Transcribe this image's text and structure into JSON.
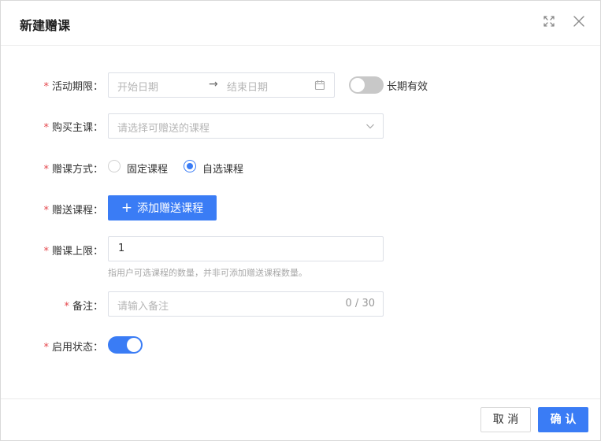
{
  "dialog": {
    "title": "新建赠课",
    "icons": [
      "fullscreen-icon",
      "close-icon"
    ]
  },
  "form": {
    "period": {
      "label": "活动期限：",
      "start_placeholder": "开始日期",
      "separator": "→",
      "end_placeholder": "结束日期",
      "long_term_label": "长期有效",
      "long_term_on": false
    },
    "main_course": {
      "label": "购买主课：",
      "placeholder": "请选择可赠送的课程"
    },
    "gift_mode": {
      "label": "赠课方式：",
      "options": [
        "固定课程",
        "自选课程"
      ],
      "selected": "自选课程"
    },
    "gift_courses": {
      "label": "赠送课程：",
      "button_icon": "+",
      "button_label": "添加赠送课程"
    },
    "limit": {
      "label": "赠课上限：",
      "value": "1",
      "hint": "指用户可选课程的数量，并非可添加赠送课程数量。"
    },
    "remark": {
      "label": "备注：",
      "placeholder": "请输入备注",
      "counter": "0 / 30"
    },
    "status": {
      "label": "启用状态：",
      "on": true
    }
  },
  "footer": {
    "cancel_label": "取 消",
    "confirm_label": "确 认"
  },
  "colors": {
    "primary": "#3a7cf5",
    "required": "#e5484d",
    "toggle_off": "#c8c8c8"
  }
}
